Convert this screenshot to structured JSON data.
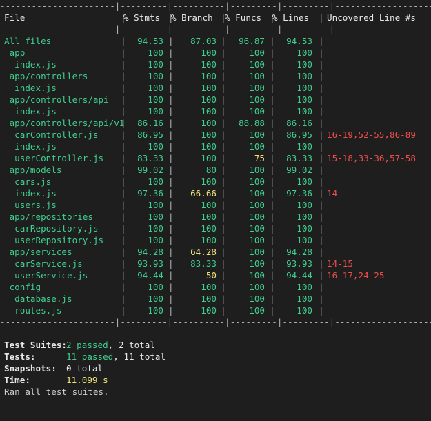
{
  "coverage_table": {
    "separator": "----------------------|---------|----------|---------|---------|-------------------",
    "headers": [
      "File",
      "% Stmts",
      "% Branch",
      "% Funcs",
      "% Lines",
      "Uncovered Line #s"
    ],
    "rows": [
      {
        "file": "All files",
        "stmts": "94.53",
        "branch": "87.03",
        "funcs": "96.87",
        "lines": "94.53",
        "uncovered": ""
      },
      {
        "file": " app",
        "stmts": "100",
        "branch": "100",
        "funcs": "100",
        "lines": "100",
        "uncovered": ""
      },
      {
        "file": "  index.js",
        "stmts": "100",
        "branch": "100",
        "funcs": "100",
        "lines": "100",
        "uncovered": ""
      },
      {
        "file": " app/controllers",
        "stmts": "100",
        "branch": "100",
        "funcs": "100",
        "lines": "100",
        "uncovered": ""
      },
      {
        "file": "  index.js",
        "stmts": "100",
        "branch": "100",
        "funcs": "100",
        "lines": "100",
        "uncovered": ""
      },
      {
        "file": " app/controllers/api",
        "stmts": "100",
        "branch": "100",
        "funcs": "100",
        "lines": "100",
        "uncovered": ""
      },
      {
        "file": "  index.js",
        "stmts": "100",
        "branch": "100",
        "funcs": "100",
        "lines": "100",
        "uncovered": ""
      },
      {
        "file": " app/controllers/api/v1",
        "stmts": "86.16",
        "branch": "100",
        "funcs": "88.88",
        "lines": "86.16",
        "uncovered": ""
      },
      {
        "file": "  carController.js",
        "stmts": "86.95",
        "branch": "100",
        "funcs": "100",
        "lines": "86.95",
        "uncovered": "16-19,52-55,86-89"
      },
      {
        "file": "  index.js",
        "stmts": "100",
        "branch": "100",
        "funcs": "100",
        "lines": "100",
        "uncovered": ""
      },
      {
        "file": "  userController.js",
        "stmts": "83.33",
        "branch": "100",
        "funcs": "75",
        "lines": "83.33",
        "uncovered": "15-18,33-36,57-58"
      },
      {
        "file": " app/models",
        "stmts": "99.02",
        "branch": "80",
        "funcs": "100",
        "lines": "99.02",
        "uncovered": ""
      },
      {
        "file": "  cars.js",
        "stmts": "100",
        "branch": "100",
        "funcs": "100",
        "lines": "100",
        "uncovered": ""
      },
      {
        "file": "  index.js",
        "stmts": "97.36",
        "branch": "66.66",
        "funcs": "100",
        "lines": "97.36",
        "uncovered": "14"
      },
      {
        "file": "  users.js",
        "stmts": "100",
        "branch": "100",
        "funcs": "100",
        "lines": "100",
        "uncovered": ""
      },
      {
        "file": " app/repositories",
        "stmts": "100",
        "branch": "100",
        "funcs": "100",
        "lines": "100",
        "uncovered": ""
      },
      {
        "file": "  carRepository.js",
        "stmts": "100",
        "branch": "100",
        "funcs": "100",
        "lines": "100",
        "uncovered": ""
      },
      {
        "file": "  userRepository.js",
        "stmts": "100",
        "branch": "100",
        "funcs": "100",
        "lines": "100",
        "uncovered": ""
      },
      {
        "file": " app/services",
        "stmts": "94.28",
        "branch": "64.28",
        "funcs": "100",
        "lines": "94.28",
        "uncovered": ""
      },
      {
        "file": "  carService.js",
        "stmts": "93.93",
        "branch": "83.33",
        "funcs": "100",
        "lines": "93.93",
        "uncovered": "14-15"
      },
      {
        "file": "  userService.js",
        "stmts": "94.44",
        "branch": "50",
        "funcs": "100",
        "lines": "94.44",
        "uncovered": "16-17,24-25"
      },
      {
        "file": " config",
        "stmts": "100",
        "branch": "100",
        "funcs": "100",
        "lines": "100",
        "uncovered": ""
      },
      {
        "file": "  database.js",
        "stmts": "100",
        "branch": "100",
        "funcs": "100",
        "lines": "100",
        "uncovered": ""
      },
      {
        "file": "  routes.js",
        "stmts": "100",
        "branch": "100",
        "funcs": "100",
        "lines": "100",
        "uncovered": ""
      }
    ]
  },
  "summary": {
    "test_suites": {
      "label": "Test Suites:",
      "passed": "2 passed",
      "rest": ", 2 total"
    },
    "tests": {
      "label": "Tests:",
      "passed": "11 passed",
      "rest": ", 11 total"
    },
    "snapshots": {
      "label": "Snapshots:",
      "value": "0 total"
    },
    "time": {
      "label": "Time:",
      "value": "11.099 s"
    },
    "footer": "Ran all test suites."
  },
  "colors": {
    "background": "#1e1e1e",
    "covered_green": "#3fcf8e",
    "medium_yellow": "#f0e37a",
    "uncovered_red": "#f14c4c"
  }
}
